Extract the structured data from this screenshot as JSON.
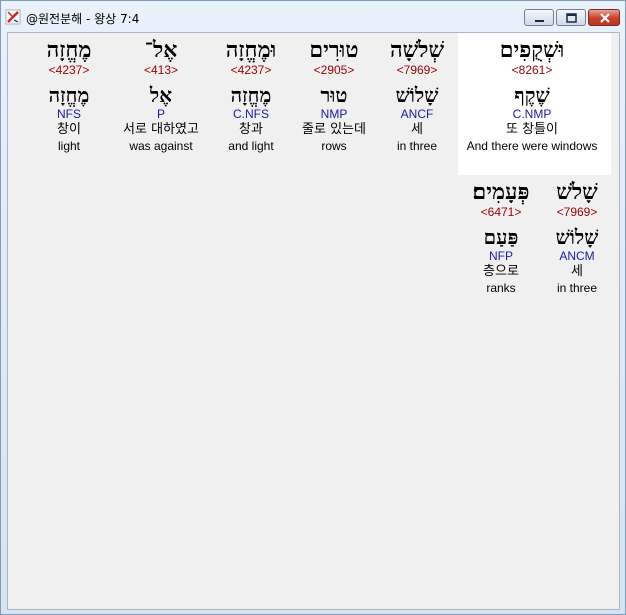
{
  "window": {
    "title": "@원전분해 - 왕상 7:4",
    "icon": "app-logo-icon",
    "controls": [
      "minimize-icon",
      "maximize-icon",
      "close-icon"
    ],
    "close_color": "#c8402a"
  },
  "colors": {
    "strong": "#990000",
    "morph": "#1a1aaa",
    "highlight_bg": "#ffffff",
    "content_bg": "#f0f0f0"
  },
  "rows": [
    {
      "words": [
        {
          "hebrew": "וּשְׁקֻפִים",
          "strong": "<8261>",
          "lemma": "שֶׁקֶף",
          "morph": "C.NMP",
          "korean": "또 창틀이",
          "english": "And there were windows",
          "highlighted": true
        },
        {
          "hebrew": "שְׁלֹשָׁה",
          "strong": "<7969>",
          "lemma": "שָׁלוֹשׁ",
          "morph": "ANCF",
          "korean": "세",
          "english": "in three",
          "highlighted": false
        },
        {
          "hebrew": "טוּרִים",
          "strong": "<2905>",
          "lemma": "טוּר",
          "morph": "NMP",
          "korean": "줄로 있는데",
          "english": "rows",
          "highlighted": false
        },
        {
          "hebrew": "וּמֶחֱזָה",
          "strong": "<4237>",
          "lemma": "מֶחֱזָה",
          "morph": "C.NFS",
          "korean": "창과",
          "english": "and light",
          "highlighted": false
        },
        {
          "hebrew": "אֶל־",
          "strong": "<413>",
          "lemma": "אֶל",
          "morph": "P",
          "korean": "서로 대하였고",
          "english": "was against",
          "highlighted": false
        },
        {
          "hebrew": "מֶחֱזָה",
          "strong": "<4237>",
          "lemma": "מֶחֱזָה",
          "morph": "NFS",
          "korean": "창이",
          "english": "light",
          "highlighted": false
        }
      ]
    },
    {
      "words": [
        {
          "hebrew": "שָׁלֹשׁ",
          "strong": "<7969>",
          "lemma": "שָׁלוֹשׁ",
          "morph": "ANCM",
          "korean": "세",
          "english": "in three",
          "highlighted": false
        },
        {
          "hebrew": "פְּעָמִים׃",
          "strong": "<6471>",
          "lemma": "פַּעַם",
          "morph": "NFP",
          "korean": "층으로",
          "english": "ranks",
          "highlighted": false
        }
      ]
    }
  ]
}
